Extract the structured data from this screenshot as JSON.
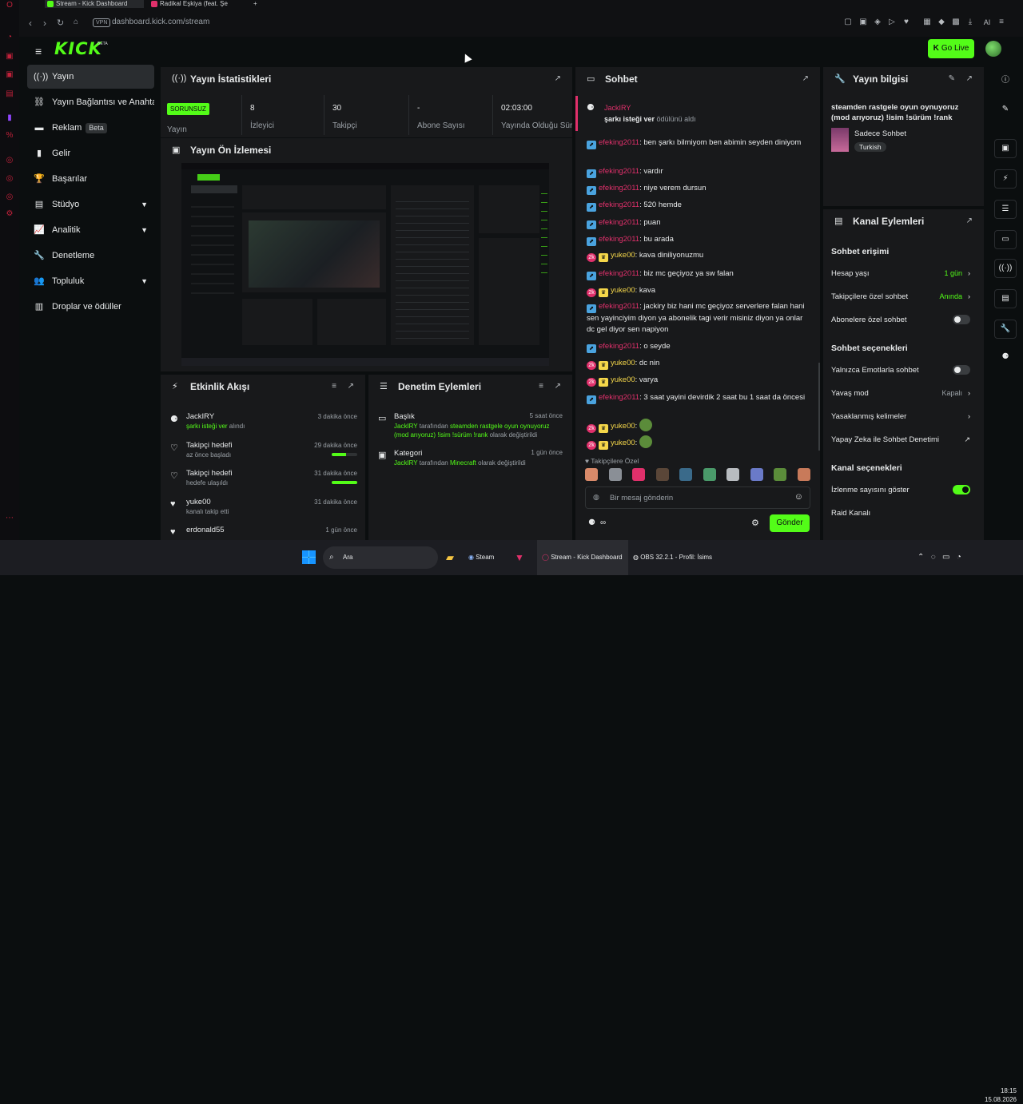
{
  "browser": {
    "tabs": [
      {
        "label": "Stream - Kick Dashboard",
        "active": true
      },
      {
        "label": "Radikal Eşkiya (feat. Şe",
        "active": false
      }
    ],
    "new_tab": "+",
    "vpn": "VPN",
    "url": "dashboard.kick.com/stream",
    "aria_label": "AI"
  },
  "header": {
    "logo": "KICK",
    "logo_badge": "BETA",
    "go_live": "Go Live"
  },
  "sidebar": {
    "items": [
      {
        "label": "Yayın",
        "icon": "stream-icon",
        "glyph": "((·))",
        "active": true
      },
      {
        "label": "Yayın Bağlantısı ve Anahtarı",
        "icon": "link-icon",
        "glyph": "⛓"
      },
      {
        "label": "Reklam",
        "badge": "Beta",
        "icon": "ad-icon",
        "glyph": "▬"
      },
      {
        "label": "Gelir",
        "icon": "revenue-icon",
        "glyph": "▮"
      },
      {
        "label": "Başarılar",
        "icon": "trophy-icon",
        "glyph": "🏆"
      },
      {
        "label": "Stüdyo",
        "icon": "studio-icon",
        "glyph": "▤",
        "chevron": true
      },
      {
        "label": "Analitik",
        "icon": "analytics-icon",
        "glyph": "📈",
        "chevron": true
      },
      {
        "label": "Denetleme",
        "icon": "wrench-icon",
        "glyph": "🔧"
      },
      {
        "label": "Topluluk",
        "icon": "community-icon",
        "glyph": "👥",
        "chevron": true
      },
      {
        "label": "Droplar ve ödüller",
        "icon": "drops-icon",
        "glyph": "▥"
      }
    ]
  },
  "stats": {
    "title": "Yayın İstatistikleri",
    "badge": "SORUNSUZ",
    "cells": [
      {
        "value": "",
        "label": "Yayın"
      },
      {
        "value": "8",
        "label": "İzleyici"
      },
      {
        "value": "30",
        "label": "Takipçi"
      },
      {
        "value": "-",
        "label": "Abone Sayısı"
      },
      {
        "value": "02:03:00",
        "label": "Yayında Olduğu Süre"
      }
    ]
  },
  "preview": {
    "title": "Yayın Ön İzlemesi"
  },
  "activity": {
    "title": "Etkinlik Akışı",
    "rows": [
      {
        "icon": "reward-icon",
        "glyph": "⚈",
        "title": "JackIRY",
        "sub_green": "şarkı isteği ver",
        "sub": " alındı",
        "time": "3 dakika önce"
      },
      {
        "icon": "heart-outline-icon",
        "glyph": "♡",
        "title": "Takipçi hedefi",
        "sub": "az önce başladı",
        "time": "29 dakika önce",
        "progress": 0.55
      },
      {
        "icon": "heart-outline-icon",
        "glyph": "♡",
        "title": "Takipçi hedefi",
        "sub": "hedefe ulaşıldı",
        "time": "31 dakika önce",
        "progress": 1.0
      },
      {
        "icon": "heart-filled-icon",
        "glyph": "♥",
        "title": "yuke00",
        "sub": "kanalı takip etti",
        "time": "31 dakika önce"
      },
      {
        "icon": "heart-filled-icon",
        "glyph": "♥",
        "title": "erdonald55",
        "sub": "",
        "time": "1 gün önce"
      }
    ]
  },
  "moderation": {
    "title": "Denetim Eylemleri",
    "rows": [
      {
        "icon": "title-icon",
        "glyph": "▭",
        "title": "Başlık",
        "time": "5 saat önce",
        "user": "JackIRY",
        "mid": " tarafından ",
        "value": "steamden rastgele oyun oynuyoruz (mod arıyoruz) !isim !sürüm !rank",
        "tail": " olarak değiştirildi"
      },
      {
        "icon": "category-icon",
        "glyph": "▣",
        "title": "Kategori",
        "time": "1 gün önce",
        "user": "JackIRY",
        "mid": " tarafından ",
        "value": "Minecraft",
        "tail": " olarak değiştirildi"
      }
    ]
  },
  "chat": {
    "title": "Sohbet",
    "pinned": {
      "user": "JackIRY",
      "text": "şarkı isteği ver",
      "tail": " ödülünü aldı"
    },
    "messages": [
      {
        "user": "efeking2011",
        "text": "ben şarkı bilmiyom ben abimin seyden diniyom",
        "kind": "pink"
      },
      {
        "user": "efeking2011",
        "text": "vardır",
        "kind": "pink"
      },
      {
        "user": "efeking2011",
        "text": "niye verem dursun",
        "kind": "pink"
      },
      {
        "user": "efeking2011",
        "text": "520 hemde",
        "kind": "pink"
      },
      {
        "user": "efeking2011",
        "text": "puan",
        "kind": "pink"
      },
      {
        "user": "efeking2011",
        "text": "bu arada",
        "kind": "pink"
      },
      {
        "user": "yuke00",
        "text": "kava diniliyonuzmu",
        "kind": "yel"
      },
      {
        "user": "efeking2011",
        "text": "biz mc geçiyoz ya sw falan",
        "kind": "pink"
      },
      {
        "user": "yuke00",
        "text": "kava",
        "kind": "yel"
      },
      {
        "user": "efeking2011",
        "text": "jackiry biz hani mc geçiyoz serverlere falan hani sen yayinciyim diyon ya abonelik tagi verir misiniz diyon ya onlar dc gel diyor sen napiyon",
        "kind": "pink"
      },
      {
        "user": "efeking2011",
        "text": "o seyde",
        "kind": "pink"
      },
      {
        "user": "yuke00",
        "text": "dc nin",
        "kind": "yel"
      },
      {
        "user": "yuke00",
        "text": "varya",
        "kind": "yel"
      },
      {
        "user": "efeking2011",
        "text": "3 saat yayini devirdik 2 saat bu 1 saat da öncesi",
        "kind": "pink"
      },
      {
        "user": "yuke00",
        "text": "",
        "kind": "yel",
        "emote": true
      },
      {
        "user": "yuke00",
        "text": "",
        "kind": "yel",
        "emote": true
      }
    ],
    "followers_only": "Takipçilere Özel",
    "input_placeholder": "Bir mesaj gönderin",
    "send": "Gönder"
  },
  "info": {
    "title": "Yayın bilgisi",
    "stream_title": "steamden rastgele oyun oynuyoruz (mod arıyoruz) !isim !sürüm !rank",
    "category": "Sadece Sohbet",
    "language": "Turkish"
  },
  "channel_actions": {
    "title": "Kanal Eylemleri",
    "chat_access": "Sohbet erişimi",
    "account_age": {
      "label": "Hesap yaşı",
      "value": "1 gün"
    },
    "followers_chat": {
      "label": "Takipçilere özel sohbet",
      "value": "Anında"
    },
    "subs_chat": {
      "label": "Abonelere özel sohbet"
    },
    "chat_options": "Sohbet seçenekleri",
    "emote_only": {
      "label": "Yalnızca Emotlarla sohbet"
    },
    "slow_mode": {
      "label": "Yavaş mod",
      "value": "Kapalı"
    },
    "banned_words": {
      "label": "Yasaklanmış kelimeler"
    },
    "ai_mod": {
      "label": "Yapay Zeka ile Sohbet Denetimi"
    },
    "channel_options": "Kanal seçenekleri",
    "viewer_count": {
      "label": "İzlenme sayısını göster"
    },
    "raid": {
      "label": "Raid Kanalı"
    }
  },
  "taskbar": {
    "search": "Ara",
    "items": [
      "Steam",
      "Stream - Kick Dashboard",
      "OBS 32.2.1 - Profil: İsims"
    ],
    "time": "18:15",
    "date": "15.08.2026"
  },
  "colors": {
    "brand": "#53fc18",
    "panel": "#18191b",
    "bg": "#0b0e0f",
    "username_pink": "#e0306b",
    "username_yellow": "#f5d74a"
  }
}
